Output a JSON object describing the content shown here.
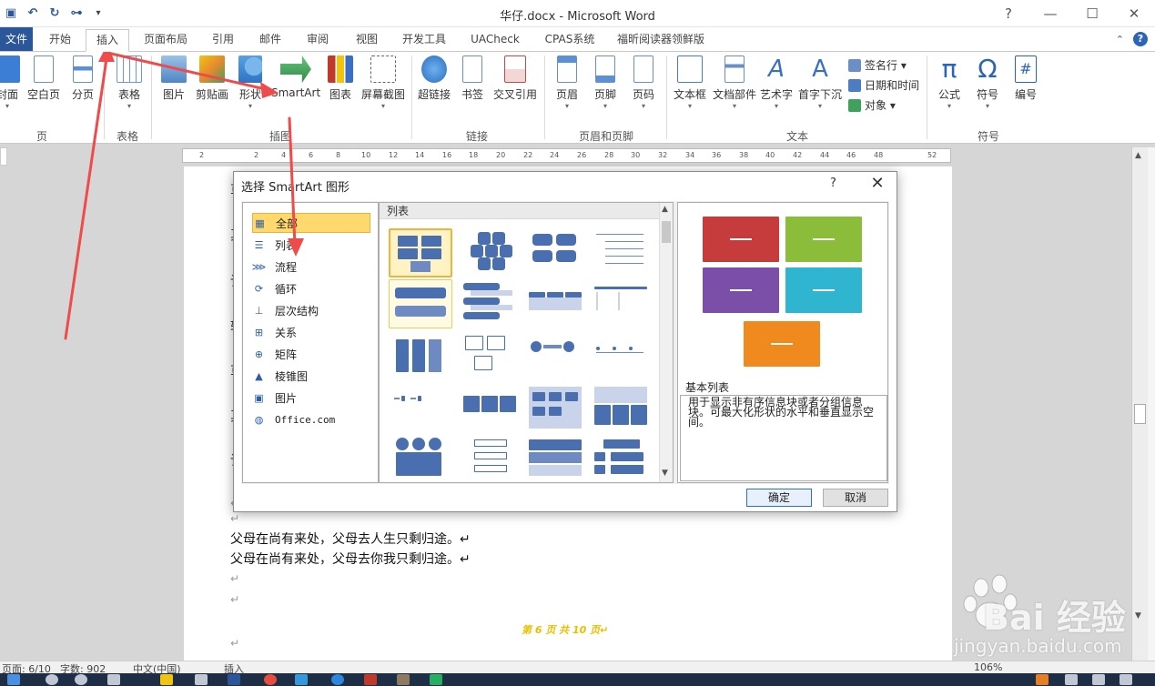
{
  "window": {
    "title": "华仔.docx - Microsoft Word",
    "controls": [
      "?",
      "—",
      "☐",
      "✕"
    ]
  },
  "qat": {
    "icons": [
      "save-icon",
      "undo-icon",
      "redo-icon",
      "structure-icon",
      "customize-icon"
    ]
  },
  "tabs": [
    {
      "label": "文件"
    },
    {
      "label": "开始"
    },
    {
      "label": "插入"
    },
    {
      "label": "页面布局"
    },
    {
      "label": "引用"
    },
    {
      "label": "邮件"
    },
    {
      "label": "审阅"
    },
    {
      "label": "视图"
    },
    {
      "label": "开发工具"
    },
    {
      "label": "UACheck"
    },
    {
      "label": "CPAS系统"
    },
    {
      "label": "福昕阅读器领鲜版"
    }
  ],
  "ribbon": {
    "buttons": [
      {
        "label": "封面",
        "color": "#3c7dd6"
      },
      {
        "label": "空白页",
        "color": "#ffffff"
      },
      {
        "label": "分页",
        "color": "#5b8fd6"
      },
      {
        "label": "表格",
        "color": "#6a9ad4"
      },
      {
        "label": "图片",
        "color": "#7aa6d8"
      },
      {
        "label": "剪贴画",
        "color": "#e58a2e"
      },
      {
        "label": "形状",
        "color": "#5aa0e0"
      },
      {
        "label": "SmartArt",
        "color": "#3fa25a"
      },
      {
        "label": "图表",
        "color": "#d9822b"
      },
      {
        "label": "屏幕截图",
        "color": "#888888"
      },
      {
        "label": "超链接",
        "color": "#3a8cd0"
      },
      {
        "label": "书签",
        "color": "#6a8fc6"
      },
      {
        "label": "交叉引用",
        "color": "#c44a4a"
      },
      {
        "label": "页眉",
        "color": "#5b8fd6"
      },
      {
        "label": "页脚",
        "color": "#5b8fd6"
      },
      {
        "label": "页码",
        "color": "#5b8fd6"
      },
      {
        "label": "文本框",
        "color": "#4a7dc2"
      },
      {
        "label": "文档部件",
        "color": "#6a8fc6"
      },
      {
        "label": "艺术字",
        "color": "#3a6fc2"
      },
      {
        "label": "首字下沉",
        "color": "#3a6fc2"
      },
      {
        "label": "公式",
        "color": "#2b64b8"
      },
      {
        "label": "符号",
        "color": "#2b64b8"
      },
      {
        "label": "编号",
        "color": "#2b64b8"
      }
    ],
    "small": [
      {
        "label": "签名行 ▾",
        "color": "#6a8fc6"
      },
      {
        "label": "日期和时间",
        "color": "#4a7dc2"
      },
      {
        "label": "对象 ▾",
        "color": "#3fa25a"
      }
    ],
    "groups": [
      "页",
      "表格",
      "插图",
      "链接",
      "页眉和页脚",
      "文本",
      "符号"
    ]
  },
  "ruler": [
    "2",
    "2",
    "4",
    "6",
    "8",
    "10",
    "12",
    "14",
    "16",
    "18",
    "20",
    "22",
    "24",
    "26",
    "28",
    "30",
    "32",
    "34",
    "36",
    "38",
    "40",
    "42",
    "44",
    "46",
    "48",
    "52"
  ],
  "document": {
    "left_chars": [
      "草",
      "其",
      "论",
      "转",
      "草",
      "其",
      "论"
    ],
    "lines": [
      "父母在尚有来处，父母去人生只剩归途。↵",
      "父母在尚有来处，父母去你我只剩归途。↵"
    ],
    "para_mark": "↵",
    "footer": "第 6 页  共 10 页↵"
  },
  "dialog": {
    "title": "选择 SmartArt 图形",
    "help": "?",
    "close": "✕",
    "categories": [
      {
        "label": "全部",
        "icon": "grid-icon"
      },
      {
        "label": "列表",
        "icon": "list-icon"
      },
      {
        "label": "流程",
        "icon": "process-icon"
      },
      {
        "label": "循环",
        "icon": "cycle-icon"
      },
      {
        "label": "层次结构",
        "icon": "hierarchy-icon"
      },
      {
        "label": "关系",
        "icon": "relationship-icon"
      },
      {
        "label": "矩阵",
        "icon": "matrix-icon"
      },
      {
        "label": "棱锥图",
        "icon": "pyramid-icon"
      },
      {
        "label": "图片",
        "icon": "picture-icon"
      },
      {
        "label": "Office.com",
        "icon": "globe-icon"
      }
    ],
    "gallery_header": "列表",
    "preview": {
      "colors": [
        "#c63c3c",
        "#8bbd3a",
        "#7b4ea8",
        "#2fb5cf",
        "#f08a1f"
      ],
      "name": "基本列表",
      "description": "用于显示非有序信息块或者分组信息块。可最大化形状的水平和垂直显示空间。"
    },
    "ok": "确定",
    "cancel": "取消"
  },
  "status": {
    "page": "页面: 6/10",
    "words": "字数: 902",
    "lang": "中文(中国)",
    "mode": "插入",
    "zoom": "106%"
  },
  "watermark": {
    "brand": "Bai 经验",
    "url": "jingyan.baidu.com"
  }
}
